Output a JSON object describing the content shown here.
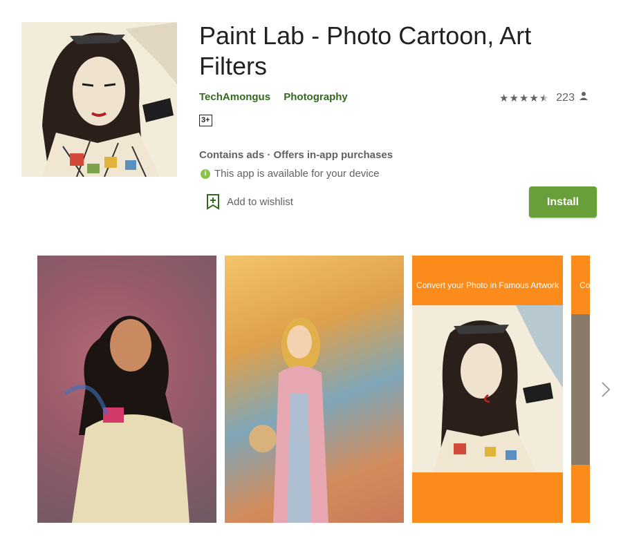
{
  "app": {
    "title": "Paint Lab - Photo Cartoon, Art Filters",
    "developer": "TechAmongus",
    "category": "Photography",
    "rating_count": "223",
    "rating_stars": 4.5,
    "age_rating": "3+",
    "ads_text": "Contains ads · Offers in-app purchases",
    "availability_text": "This app is available for your device",
    "availability_icon": "i"
  },
  "actions": {
    "wishlist_label": "Add to wishlist",
    "install_label": "Install"
  },
  "screenshots": {
    "caption_3": "Convert your Photo in Famous Artwork",
    "caption_4": "Co"
  },
  "colors": {
    "accent_green": "#689f38",
    "link_green": "#33691e",
    "screenshot_orange": "#fb8c1c"
  }
}
